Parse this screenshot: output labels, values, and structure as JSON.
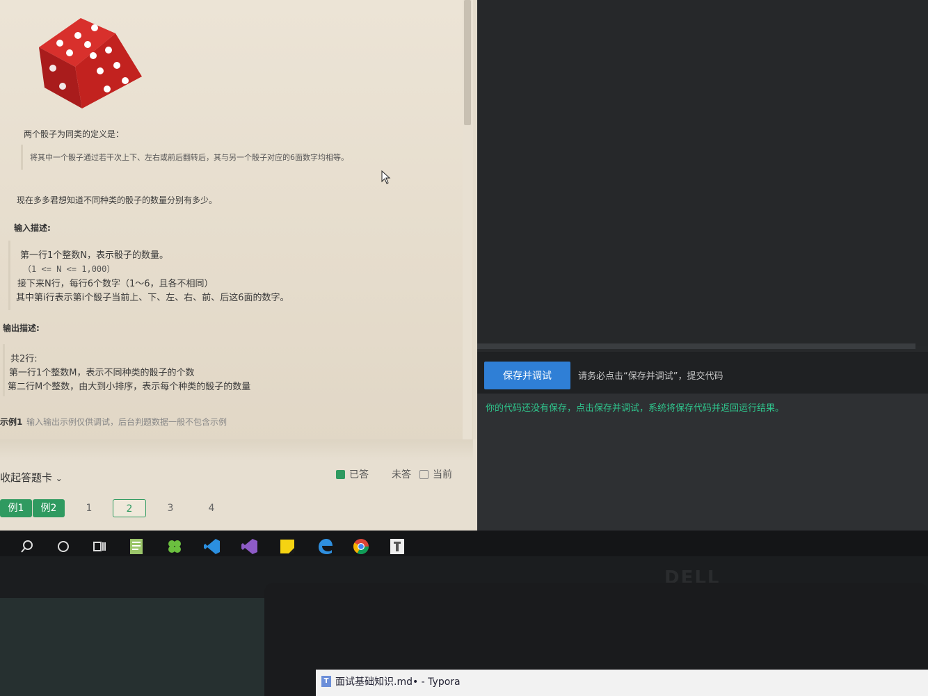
{
  "problem": {
    "definition_heading": "两个骰子为同类的定义是：",
    "definition_quote": "将其中一个骰子通过若干次上下、左右或前后翻转后，其与另一个骰子对应的6面数字均相等。",
    "question": "现在多多君想知道不同种类的骰子的数量分别有多少。",
    "input_heading": "输入描述:",
    "input_lines": [
      "第一行1个整数N，表示骰子的数量。",
      "（1 <= N <= 1,000）",
      "接下来N行，每行6个数字（1～6，且各不相同）",
      "其中第i行表示第i个骰子当前上、下、左、右、前、后这6面的数字。"
    ],
    "output_heading": "输出描述:",
    "output_lines": [
      "共2行:",
      "第一行1个整数M，表示不同种类的骰子的个数",
      "第二行M个整数，由大到小排序，表示每个种类的骰子的数量"
    ],
    "example_label": "示例1",
    "example_note": "输入输出示例仅供调试，后台判题数据一般不包含示例"
  },
  "answer_card": {
    "collapse_label": "收起答题卡",
    "legend_answered": "已答",
    "legend_unanswered": "未答",
    "legend_current": "当前",
    "chips": [
      "例1",
      "例2",
      "1",
      "2",
      "3",
      "4"
    ],
    "answered_color": "#2f9a60"
  },
  "editor": {
    "save_button": "保存并调试",
    "hint": "请务必点击“保存并调试”，提交代码",
    "result_message": "你的代码还没有保存，点击保存并调试，系统将保存代码并返回运行结果。",
    "accent_color": "#2f7fd6",
    "result_color": "#2fc48c"
  },
  "taskbar": {
    "icons": [
      "search-icon",
      "cortana-icon",
      "task-view-icon",
      "notepad-icon",
      "clover-icon",
      "vscode-icon",
      "visual-studio-icon",
      "sticky-notes-icon",
      "edge-icon",
      "chrome-icon",
      "typora-icon"
    ]
  },
  "monitor": {
    "brand": "DELL"
  },
  "laptop": {
    "window_title": "面试基础知识.md• - Typora"
  }
}
